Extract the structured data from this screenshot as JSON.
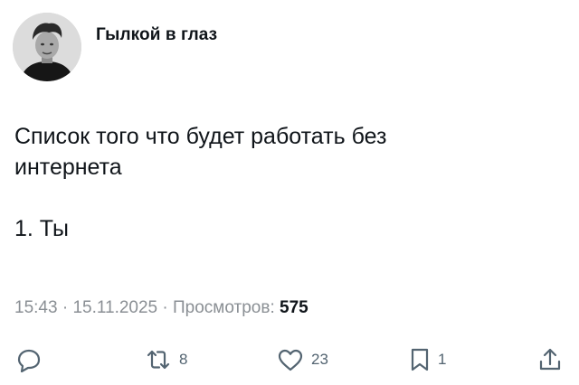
{
  "author": {
    "name": "Гылкой в глаз"
  },
  "post": {
    "text": "Список того что будет работать без\nинтернета\n\n1. Ты"
  },
  "meta": {
    "time": "15:43",
    "separator": " · ",
    "date": "15.11.2025",
    "views_label": "Просмотров: ",
    "views_count": "575"
  },
  "actions": {
    "reply": {
      "icon": "reply-icon",
      "count": ""
    },
    "retweet": {
      "icon": "retweet-icon",
      "count": "8"
    },
    "like": {
      "icon": "heart-icon",
      "count": "23"
    },
    "bookmark": {
      "icon": "bookmark-icon",
      "count": "1"
    },
    "share": {
      "icon": "share-icon",
      "count": ""
    }
  },
  "colors": {
    "text": "#0f1419",
    "meta": "#8a8f94",
    "icon": "#536471"
  }
}
